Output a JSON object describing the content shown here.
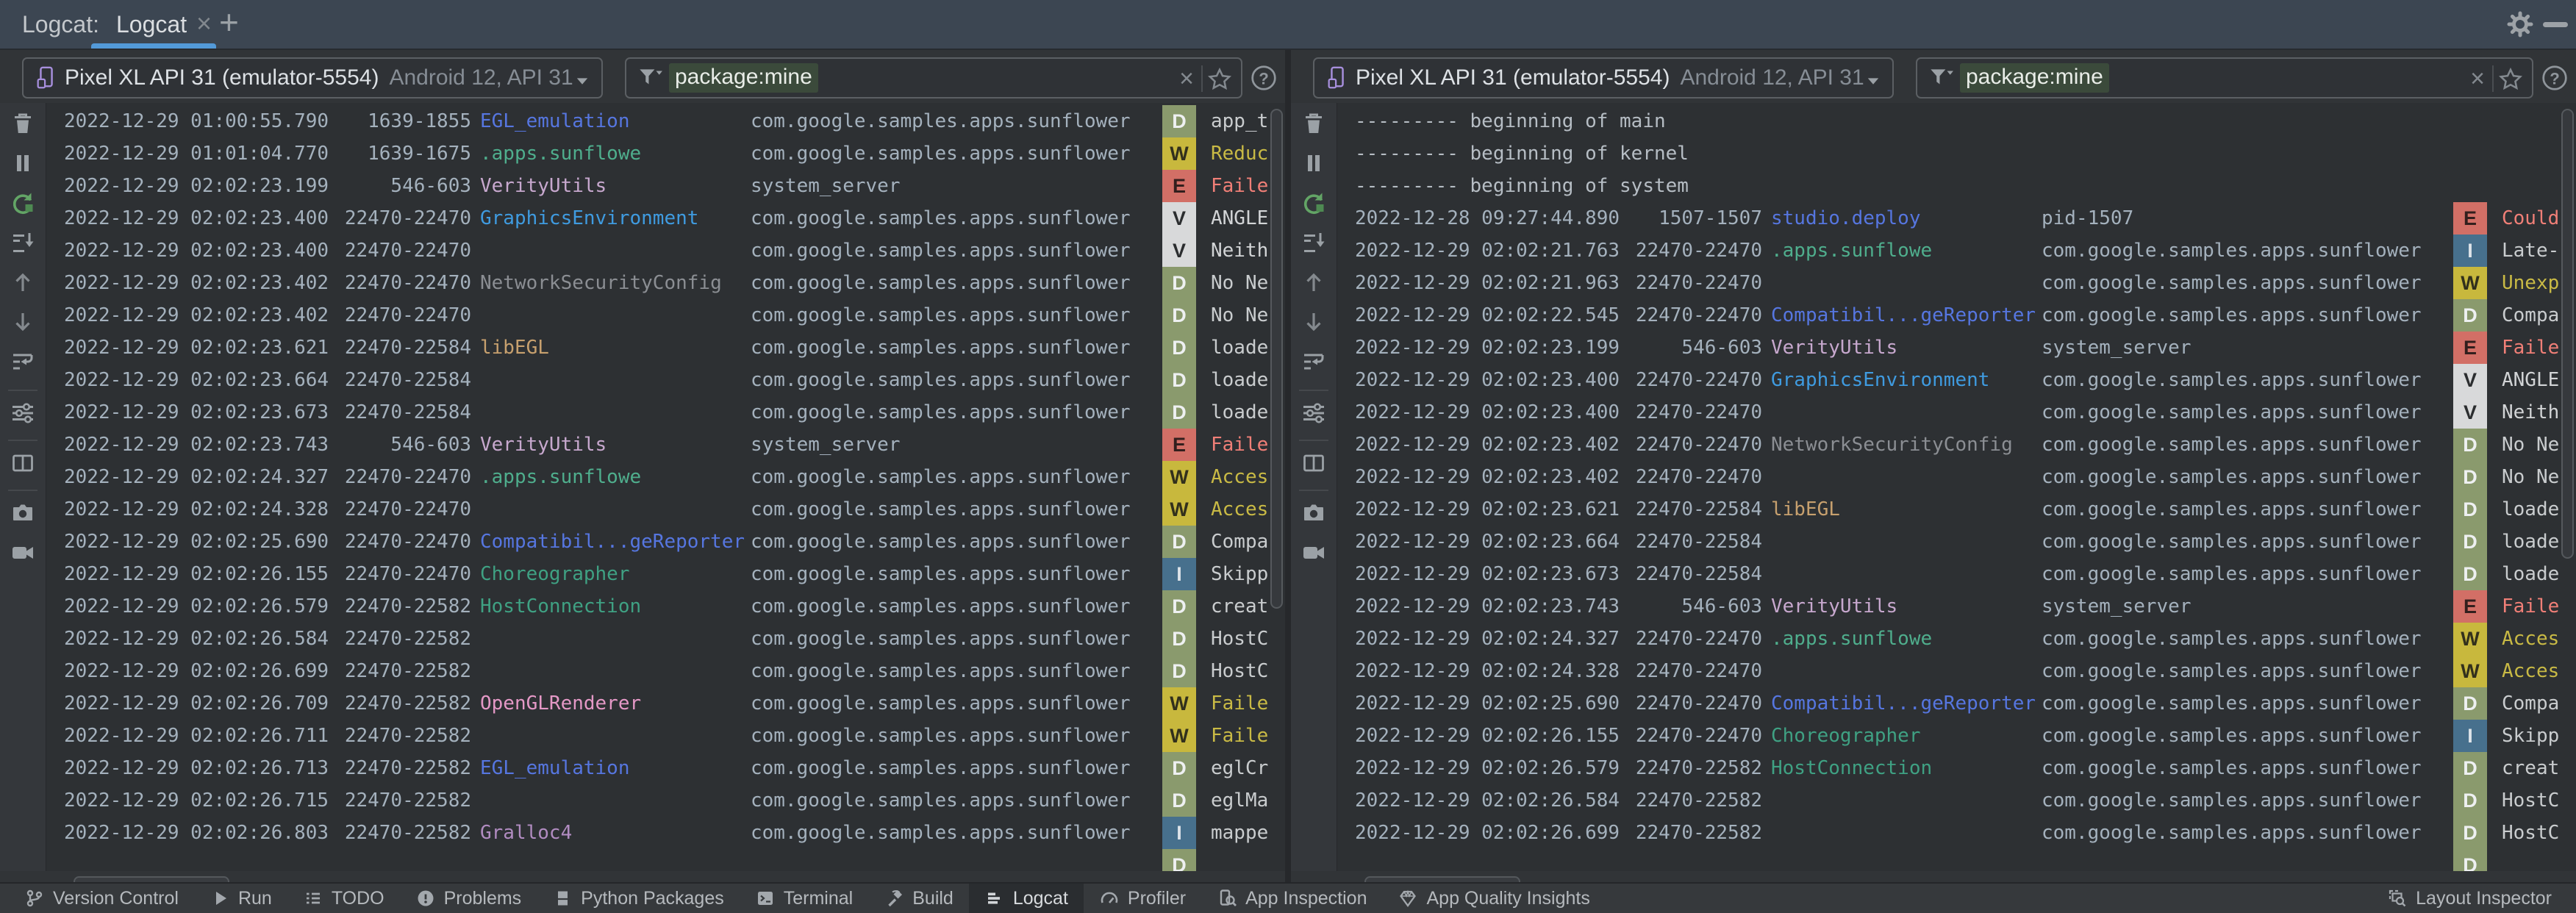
{
  "chrome": {
    "group_label": "Logcat:",
    "tab_label": "Logcat",
    "close_glyph": "×",
    "add_glyph": "+"
  },
  "colors": {
    "accent": "#539ad9",
    "filter_chip_bg": "#3b4a3b",
    "tags": {
      "blue": "#5676e0",
      "teal": "#4fae8d",
      "teal2": "#3fa183",
      "mauve": "#c7a8ce",
      "mauve2": "#b18cc1",
      "lightblue": "#3f9be0",
      "gray": "#8b8e93",
      "tan": "#c7a06e",
      "pink": "#e498c6"
    },
    "levels": {
      "D": {
        "badge": "#8a9a6d",
        "letter": "#eef0f1",
        "msg": "#c9ccce"
      },
      "W": {
        "badge": "#c8b83d",
        "letter": "#32301c",
        "msg": "#c9ba45"
      },
      "E": {
        "badge": "#d26f66",
        "letter": "#321f1d",
        "msg": "#f07f77"
      },
      "V": {
        "badge": "#d8d9da",
        "letter": "#2b2d2f",
        "msg": "#d2d4d6"
      },
      "I": {
        "badge": "#47708d",
        "letter": "#dde3e8",
        "msg": "#c9ccce"
      }
    }
  },
  "panels": [
    {
      "device": {
        "name": "Pixel XL API 31 (emulator-5554)",
        "details": "Android 12, API 31"
      },
      "filter": {
        "value": "package:mine",
        "clear_glyph": "×"
      },
      "scrollbar": {
        "vtop": 8,
        "vheight": 680
      },
      "rows": [
        {
          "ts": "2022-12-29 01:00:55.790",
          "pid": "1639-1855",
          "tag": "EGL_emulation",
          "tag_color": "blue",
          "pkg": "com.google.samples.apps.sunflower",
          "level": "D",
          "msg": "app_t"
        },
        {
          "ts": "2022-12-29 01:01:04.770",
          "pid": "1639-1675",
          "tag": ".apps.sunflowe",
          "tag_color": "teal",
          "pkg": "com.google.samples.apps.sunflower",
          "level": "W",
          "msg": "Reduc"
        },
        {
          "ts": "2022-12-29 02:02:23.199",
          "pid": "546-603",
          "tag": "VerityUtils",
          "tag_color": "mauve",
          "pkg": "system_server",
          "level": "E",
          "msg": "Faile"
        },
        {
          "ts": "2022-12-29 02:02:23.400",
          "pid": "22470-22470",
          "tag": "GraphicsEnvironment",
          "tag_color": "lightblue",
          "pkg": "com.google.samples.apps.sunflower",
          "level": "V",
          "msg": "ANGLE"
        },
        {
          "ts": "2022-12-29 02:02:23.400",
          "pid": "22470-22470",
          "tag": "",
          "tag_color": "",
          "pkg": "com.google.samples.apps.sunflower",
          "level": "V",
          "msg": "Neith"
        },
        {
          "ts": "2022-12-29 02:02:23.402",
          "pid": "22470-22470",
          "tag": "NetworkSecurityConfig",
          "tag_color": "gray",
          "pkg": "com.google.samples.apps.sunflower",
          "level": "D",
          "msg": "No Ne"
        },
        {
          "ts": "2022-12-29 02:02:23.402",
          "pid": "22470-22470",
          "tag": "",
          "tag_color": "",
          "pkg": "com.google.samples.apps.sunflower",
          "level": "D",
          "msg": "No Ne"
        },
        {
          "ts": "2022-12-29 02:02:23.621",
          "pid": "22470-22584",
          "tag": "libEGL",
          "tag_color": "tan",
          "pkg": "com.google.samples.apps.sunflower",
          "level": "D",
          "msg": "loade"
        },
        {
          "ts": "2022-12-29 02:02:23.664",
          "pid": "22470-22584",
          "tag": "",
          "tag_color": "",
          "pkg": "com.google.samples.apps.sunflower",
          "level": "D",
          "msg": "loade"
        },
        {
          "ts": "2022-12-29 02:02:23.673",
          "pid": "22470-22584",
          "tag": "",
          "tag_color": "",
          "pkg": "com.google.samples.apps.sunflower",
          "level": "D",
          "msg": "loade"
        },
        {
          "ts": "2022-12-29 02:02:23.743",
          "pid": "546-603",
          "tag": "VerityUtils",
          "tag_color": "mauve",
          "pkg": "system_server",
          "level": "E",
          "msg": "Faile"
        },
        {
          "ts": "2022-12-29 02:02:24.327",
          "pid": "22470-22470",
          "tag": ".apps.sunflowe",
          "tag_color": "teal",
          "pkg": "com.google.samples.apps.sunflower",
          "level": "W",
          "msg": "Acces"
        },
        {
          "ts": "2022-12-29 02:02:24.328",
          "pid": "22470-22470",
          "tag": "",
          "tag_color": "",
          "pkg": "com.google.samples.apps.sunflower",
          "level": "W",
          "msg": "Acces"
        },
        {
          "ts": "2022-12-29 02:02:25.690",
          "pid": "22470-22470",
          "tag": "Compatibil...geReporter",
          "tag_color": "blue",
          "pkg": "com.google.samples.apps.sunflower",
          "level": "D",
          "msg": "Compa"
        },
        {
          "ts": "2022-12-29 02:02:26.155",
          "pid": "22470-22470",
          "tag": "Choreographer",
          "tag_color": "teal2",
          "pkg": "com.google.samples.apps.sunflower",
          "level": "I",
          "msg": "Skipp"
        },
        {
          "ts": "2022-12-29 02:02:26.579",
          "pid": "22470-22582",
          "tag": "HostConnection",
          "tag_color": "teal2",
          "pkg": "com.google.samples.apps.sunflower",
          "level": "D",
          "msg": "creat"
        },
        {
          "ts": "2022-12-29 02:02:26.584",
          "pid": "22470-22582",
          "tag": "",
          "tag_color": "",
          "pkg": "com.google.samples.apps.sunflower",
          "level": "D",
          "msg": "HostC"
        },
        {
          "ts": "2022-12-29 02:02:26.699",
          "pid": "22470-22582",
          "tag": "",
          "tag_color": "",
          "pkg": "com.google.samples.apps.sunflower",
          "level": "D",
          "msg": "HostC"
        },
        {
          "ts": "2022-12-29 02:02:26.709",
          "pid": "22470-22582",
          "tag": "OpenGLRenderer",
          "tag_color": "pink",
          "pkg": "com.google.samples.apps.sunflower",
          "level": "W",
          "msg": "Faile"
        },
        {
          "ts": "2022-12-29 02:02:26.711",
          "pid": "22470-22582",
          "tag": "",
          "tag_color": "",
          "pkg": "com.google.samples.apps.sunflower",
          "level": "W",
          "msg": "Faile"
        },
        {
          "ts": "2022-12-29 02:02:26.713",
          "pid": "22470-22582",
          "tag": "EGL_emulation",
          "tag_color": "blue",
          "pkg": "com.google.samples.apps.sunflower",
          "level": "D",
          "msg": "eglCr"
        },
        {
          "ts": "2022-12-29 02:02:26.715",
          "pid": "22470-22582",
          "tag": "",
          "tag_color": "",
          "pkg": "com.google.samples.apps.sunflower",
          "level": "D",
          "msg": "eglMa"
        },
        {
          "ts": "2022-12-29 02:02:26.803",
          "pid": "22470-22582",
          "tag": "Gralloc4",
          "tag_color": "mauve2",
          "pkg": "com.google.samples.apps.sunflower",
          "level": "I",
          "msg": "mappe"
        },
        {
          "ts": "",
          "pid": "",
          "tag": "",
          "tag_color": "",
          "pkg": "",
          "level": "D",
          "msg": ""
        }
      ]
    },
    {
      "device": {
        "name": "Pixel XL API 31 (emulator-5554)",
        "details": "Android 12, API 31"
      },
      "filter": {
        "value": "package:mine",
        "clear_glyph": "×"
      },
      "scrollbar": {
        "vtop": 8,
        "vheight": 612
      },
      "rows": [
        {
          "raw": "--------- beginning of main"
        },
        {
          "raw": "--------- beginning of kernel"
        },
        {
          "raw": "--------- beginning of system"
        },
        {
          "ts": "2022-12-28 09:27:44.890",
          "pid": "1507-1507",
          "tag": "studio.deploy",
          "tag_color": "blue",
          "pkg": "pid-1507",
          "level": "E",
          "msg": "Could"
        },
        {
          "ts": "2022-12-29 02:02:21.763",
          "pid": "22470-22470",
          "tag": ".apps.sunflowe",
          "tag_color": "teal",
          "pkg": "com.google.samples.apps.sunflower",
          "level": "I",
          "msg": "Late-"
        },
        {
          "ts": "2022-12-29 02:02:21.963",
          "pid": "22470-22470",
          "tag": "",
          "tag_color": "",
          "pkg": "com.google.samples.apps.sunflower",
          "level": "W",
          "msg": "Unexp"
        },
        {
          "ts": "2022-12-29 02:02:22.545",
          "pid": "22470-22470",
          "tag": "Compatibil...geReporter",
          "tag_color": "blue",
          "pkg": "com.google.samples.apps.sunflower",
          "level": "D",
          "msg": "Compa"
        },
        {
          "ts": "2022-12-29 02:02:23.199",
          "pid": "546-603",
          "tag": "VerityUtils",
          "tag_color": "mauve",
          "pkg": "system_server",
          "level": "E",
          "msg": "Faile"
        },
        {
          "ts": "2022-12-29 02:02:23.400",
          "pid": "22470-22470",
          "tag": "GraphicsEnvironment",
          "tag_color": "lightblue",
          "pkg": "com.google.samples.apps.sunflower",
          "level": "V",
          "msg": "ANGLE"
        },
        {
          "ts": "2022-12-29 02:02:23.400",
          "pid": "22470-22470",
          "tag": "",
          "tag_color": "",
          "pkg": "com.google.samples.apps.sunflower",
          "level": "V",
          "msg": "Neith"
        },
        {
          "ts": "2022-12-29 02:02:23.402",
          "pid": "22470-22470",
          "tag": "NetworkSecurityConfig",
          "tag_color": "gray",
          "pkg": "com.google.samples.apps.sunflower",
          "level": "D",
          "msg": "No Ne"
        },
        {
          "ts": "2022-12-29 02:02:23.402",
          "pid": "22470-22470",
          "tag": "",
          "tag_color": "",
          "pkg": "com.google.samples.apps.sunflower",
          "level": "D",
          "msg": "No Ne"
        },
        {
          "ts": "2022-12-29 02:02:23.621",
          "pid": "22470-22584",
          "tag": "libEGL",
          "tag_color": "tan",
          "pkg": "com.google.samples.apps.sunflower",
          "level": "D",
          "msg": "loade"
        },
        {
          "ts": "2022-12-29 02:02:23.664",
          "pid": "22470-22584",
          "tag": "",
          "tag_color": "",
          "pkg": "com.google.samples.apps.sunflower",
          "level": "D",
          "msg": "loade"
        },
        {
          "ts": "2022-12-29 02:02:23.673",
          "pid": "22470-22584",
          "tag": "",
          "tag_color": "",
          "pkg": "com.google.samples.apps.sunflower",
          "level": "D",
          "msg": "loade"
        },
        {
          "ts": "2022-12-29 02:02:23.743",
          "pid": "546-603",
          "tag": "VerityUtils",
          "tag_color": "mauve",
          "pkg": "system_server",
          "level": "E",
          "msg": "Faile"
        },
        {
          "ts": "2022-12-29 02:02:24.327",
          "pid": "22470-22470",
          "tag": ".apps.sunflowe",
          "tag_color": "teal",
          "pkg": "com.google.samples.apps.sunflower",
          "level": "W",
          "msg": "Acces"
        },
        {
          "ts": "2022-12-29 02:02:24.328",
          "pid": "22470-22470",
          "tag": "",
          "tag_color": "",
          "pkg": "com.google.samples.apps.sunflower",
          "level": "W",
          "msg": "Acces"
        },
        {
          "ts": "2022-12-29 02:02:25.690",
          "pid": "22470-22470",
          "tag": "Compatibil...geReporter",
          "tag_color": "blue",
          "pkg": "com.google.samples.apps.sunflower",
          "level": "D",
          "msg": "Compa"
        },
        {
          "ts": "2022-12-29 02:02:26.155",
          "pid": "22470-22470",
          "tag": "Choreographer",
          "tag_color": "teal2",
          "pkg": "com.google.samples.apps.sunflower",
          "level": "I",
          "msg": "Skipp"
        },
        {
          "ts": "2022-12-29 02:02:26.579",
          "pid": "22470-22582",
          "tag": "HostConnection",
          "tag_color": "teal2",
          "pkg": "com.google.samples.apps.sunflower",
          "level": "D",
          "msg": "creat"
        },
        {
          "ts": "2022-12-29 02:02:26.584",
          "pid": "22470-22582",
          "tag": "",
          "tag_color": "",
          "pkg": "com.google.samples.apps.sunflower",
          "level": "D",
          "msg": "HostC"
        },
        {
          "ts": "2022-12-29 02:02:26.699",
          "pid": "22470-22582",
          "tag": "",
          "tag_color": "",
          "pkg": "com.google.samples.apps.sunflower",
          "level": "D",
          "msg": "HostC"
        },
        {
          "ts": "",
          "pid": "",
          "tag": "",
          "tag_color": "",
          "pkg": "",
          "level": "D",
          "msg": ""
        }
      ]
    }
  ],
  "toolbar": [
    {
      "name": "clear-logcat-icon"
    },
    {
      "name": "pause-logcat-icon"
    },
    {
      "name": "restart-logcat-icon"
    },
    {
      "name": "scroll-to-end-icon"
    },
    {
      "name": "previous-occurrence-icon"
    },
    {
      "name": "next-occurrence-icon"
    },
    {
      "name": "soft-wrap-icon"
    },
    {
      "name": "separator"
    },
    {
      "name": "configure-logcat-icon"
    },
    {
      "name": "separator"
    },
    {
      "name": "split-panels-icon"
    },
    {
      "name": "separator"
    },
    {
      "name": "screenshot-icon"
    },
    {
      "name": "screen-record-icon"
    }
  ],
  "status_bar": {
    "left": [
      {
        "icon": "git-branch-icon",
        "label": "Version Control"
      },
      {
        "icon": "run-icon",
        "label": "Run"
      },
      {
        "icon": "todo-icon",
        "label": "TODO"
      },
      {
        "icon": "problems-icon",
        "label": "Problems"
      },
      {
        "icon": "python-packages-icon",
        "label": "Python Packages"
      },
      {
        "icon": "terminal-icon",
        "label": "Terminal"
      },
      {
        "icon": "build-icon",
        "label": "Build"
      },
      {
        "icon": "logcat-icon",
        "label": "Logcat",
        "active": true
      },
      {
        "icon": "profiler-icon",
        "label": "Profiler"
      },
      {
        "icon": "app-inspection-icon",
        "label": "App Inspection"
      },
      {
        "icon": "app-quality-insights-icon",
        "label": "App Quality Insights"
      }
    ],
    "right": [
      {
        "icon": "layout-inspector-icon",
        "label": "Layout Inspector"
      }
    ]
  }
}
